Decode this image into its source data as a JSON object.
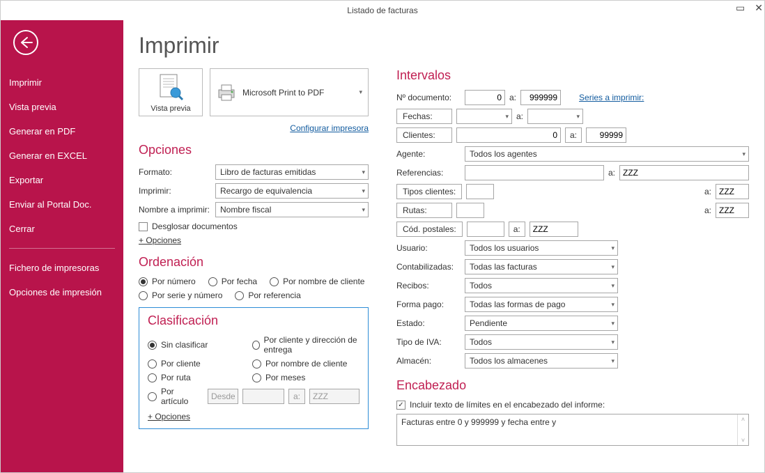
{
  "window": {
    "title": "Listado de facturas"
  },
  "sidebar": {
    "items": [
      "Imprimir",
      "Vista previa",
      "Generar en PDF",
      "Generar en EXCEL",
      "Exportar",
      "Enviar al Portal Doc.",
      "Cerrar"
    ],
    "items2": [
      "Fichero de impresoras",
      "Opciones de impresión"
    ]
  },
  "page_title": "Imprimir",
  "preview": {
    "label": "Vista previa"
  },
  "printer": {
    "name": "Microsoft Print to PDF",
    "config_link": "Configurar impresora"
  },
  "opciones": {
    "heading": "Opciones",
    "formato_label": "Formato:",
    "formato_value": "Libro de facturas emitidas",
    "imprimir_label": "Imprimir:",
    "imprimir_value": "Recargo de equivalencia",
    "nombre_label": "Nombre a imprimir:",
    "nombre_value": "Nombre fiscal",
    "desglosar": "Desglosar documentos",
    "mas": "+ Opciones"
  },
  "ordenacion": {
    "heading": "Ordenación",
    "por_numero": "Por número",
    "por_fecha": "Por fecha",
    "por_nombre": "Por nombre de cliente",
    "por_serie": "Por serie y número",
    "por_referencia": "Por referencia"
  },
  "clasificacion": {
    "heading": "Clasificación",
    "sin": "Sin clasificar",
    "por_cli_dir": "Por cliente y dirección de entrega",
    "por_cliente": "Por cliente",
    "por_nombre": "Por nombre de cliente",
    "por_ruta": "Por ruta",
    "por_meses": "Por meses",
    "por_articulo": "Por artículo",
    "desde": "Desde:",
    "a": "a:",
    "a_val": "ZZZ",
    "mas": "+ Opciones"
  },
  "intervalos": {
    "heading": "Intervalos",
    "ndoc_label": "Nº documento:",
    "ndoc_from": "0",
    "ndoc_a": "a:",
    "ndoc_to": "999999",
    "series_link": "Series a imprimir:",
    "fechas_btn": "Fechas:",
    "fechas_a": "a:",
    "clientes_btn": "Clientes:",
    "clientes_from": "0",
    "clientes_a": "a:",
    "clientes_to": "99999",
    "agente_label": "Agente:",
    "agente_val": "Todos los agentes",
    "ref_label": "Referencias:",
    "ref_a": "a:",
    "ref_to": "ZZZ",
    "tipos_btn": "Tipos clientes:",
    "tipos_a": "a:",
    "tipos_to": "ZZZ",
    "rutas_btn": "Rutas:",
    "rutas_a": "a:",
    "rutas_to": "ZZZ",
    "cod_btn": "Cód. postales:",
    "cod_a": "a:",
    "cod_to": "ZZZ",
    "usuario_label": "Usuario:",
    "usuario_val": "Todos los usuarios",
    "contab_label": "Contabilizadas:",
    "contab_val": "Todas las facturas",
    "recibos_label": "Recibos:",
    "recibos_val": "Todos",
    "forma_label": "Forma pago:",
    "forma_val": "Todas las formas de pago",
    "estado_label": "Estado:",
    "estado_val": "Pendiente",
    "tipoiva_label": "Tipo de IVA:",
    "tipoiva_val": "Todos",
    "almacen_label": "Almacén:",
    "almacen_val": "Todos los almacenes"
  },
  "encabezado": {
    "heading": "Encabezado",
    "check_label": "Incluir texto de límites en el encabezado del informe:",
    "text": "Facturas entre 0 y 999999 y fecha entre y"
  }
}
